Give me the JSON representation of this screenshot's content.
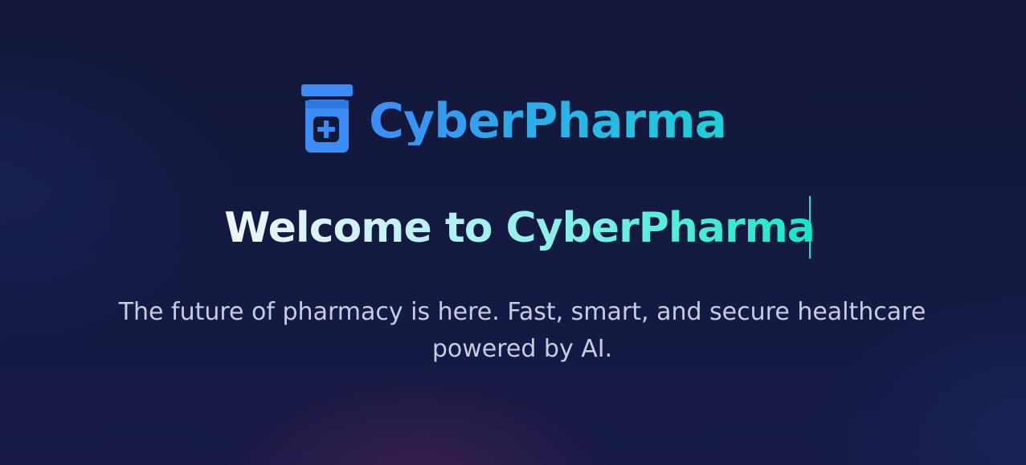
{
  "brand": {
    "name": "CyberPharma",
    "icon": "pill-bottle-icon",
    "gradient": [
      "#3b8cf6",
      "#1cd2d8"
    ]
  },
  "hero": {
    "title": "Welcome to CyberPharma",
    "subtitle_line_1": "The future of pharmacy is here. Fast, smart, and secure healthcare",
    "subtitle_line_2": "powered by AI.",
    "title_gradient": [
      "#f1f4fb",
      "#13e6c8"
    ],
    "caret_color": "#1fe2c5"
  },
  "colors": {
    "background": "#121838",
    "subtitle_text": "#c9cbe1",
    "icon": "#3b8cf6"
  }
}
